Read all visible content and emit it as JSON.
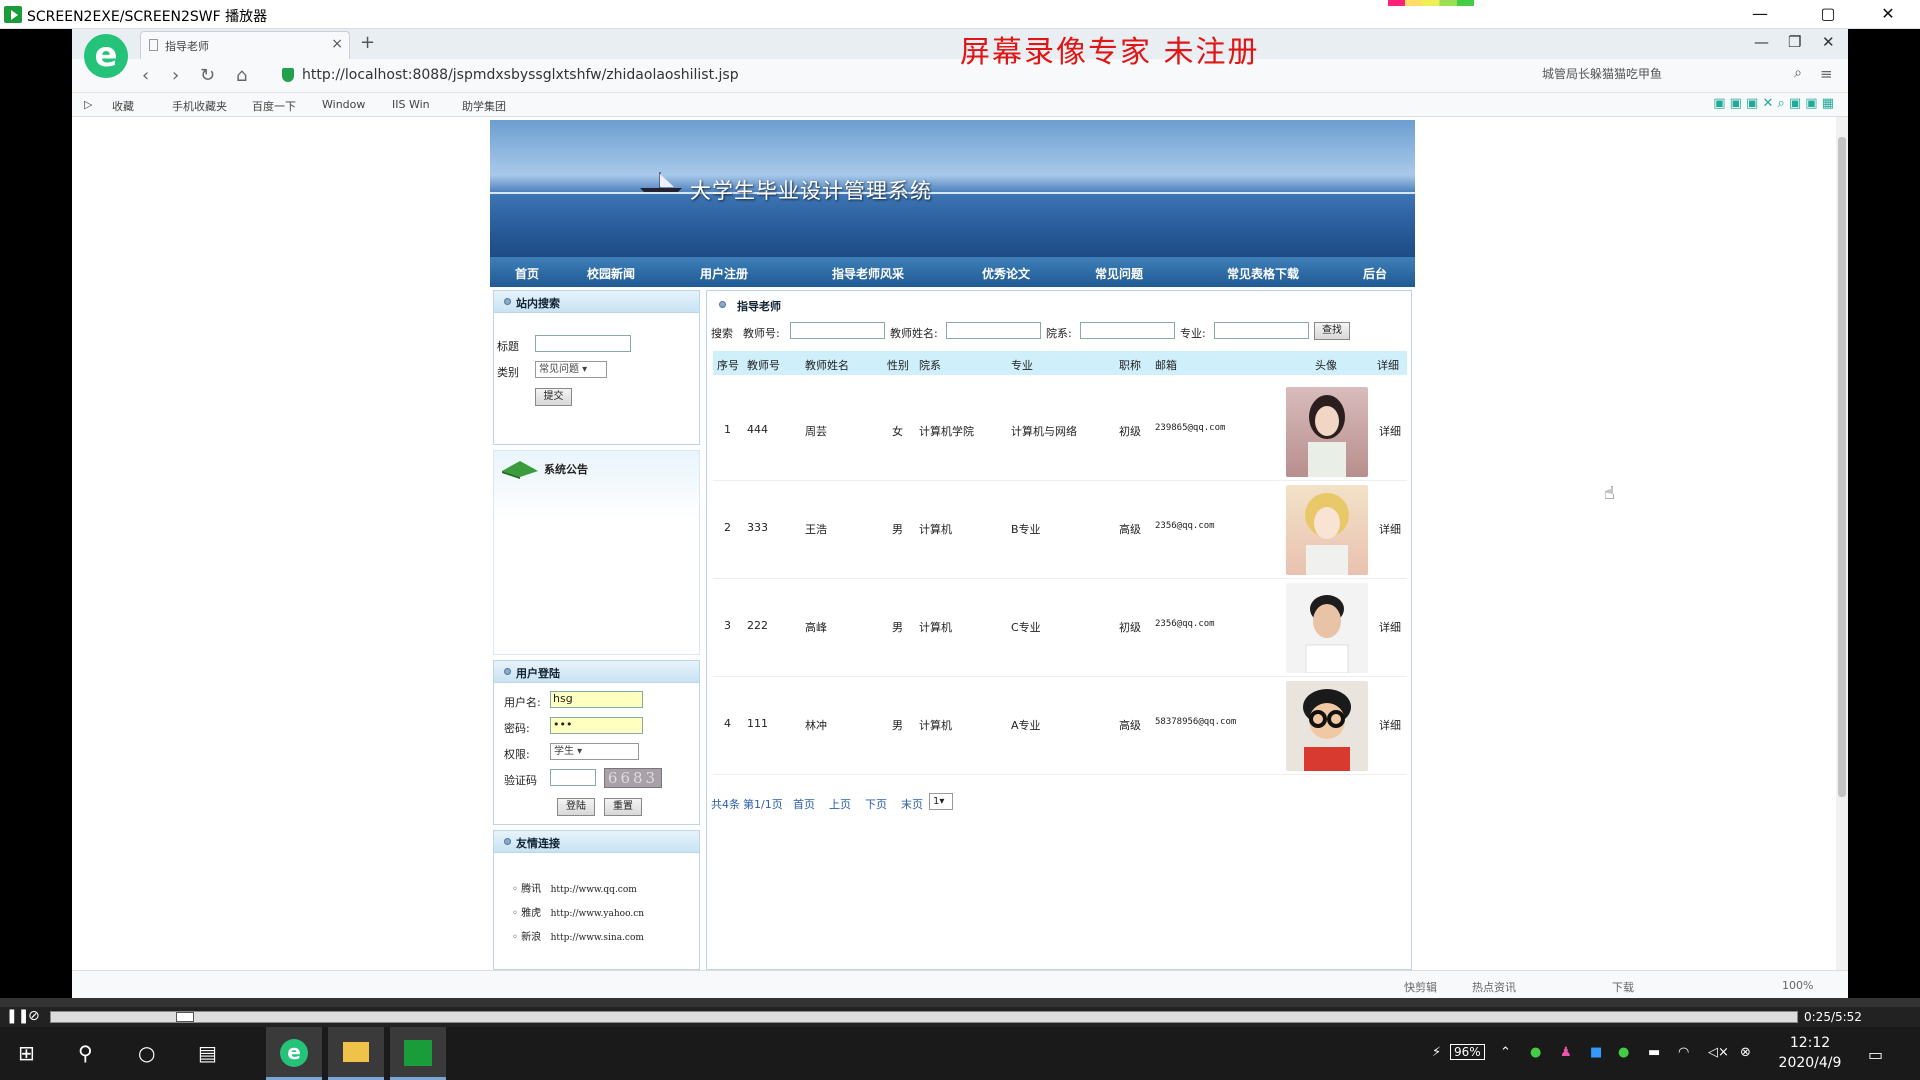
{
  "window": {
    "title": "SCREEN2EXE/SCREEN2SWF 播放器",
    "min": "—",
    "max": "▢",
    "close": "✕"
  },
  "overlay": "屏幕录像专家 未注册",
  "browser": {
    "tab_title": "指导老师",
    "url": "http://localhost:8088/jspmdxsbyssglxtshfw/zhidaolaoshilist.jsp",
    "search_text": "城管局长躲猫猫吃甲鱼",
    "bookmarks": [
      "收藏",
      "手机收藏夹",
      "百度一下",
      "Window",
      "IIS Win",
      "助学集团"
    ],
    "status": [
      "快剪辑",
      "热点资讯",
      "下载",
      "100%"
    ]
  },
  "site": {
    "banner_title": "大学生毕业设计管理系统",
    "menu": [
      "首页",
      "校园新闻",
      "用户注册",
      "指导老师风采",
      "优秀论文",
      "常见问题",
      "常见表格下载",
      "后台"
    ],
    "search_panel": {
      "title": "站内搜索",
      "label_title": "标题",
      "label_type": "类别",
      "type_value": "常见问题",
      "submit": "提交"
    },
    "notice_panel": {
      "title": "系统公告"
    },
    "login_panel": {
      "title": "用户登陆",
      "label_user": "用户名:",
      "user_value": "hsg",
      "label_pass": "密码:",
      "pass_value": "•••",
      "label_role": "权限:",
      "role_value": "学生",
      "label_code": "验证码",
      "code_value": "6683",
      "login_btn": "登陆",
      "reset_btn": "重置"
    },
    "links_panel": {
      "title": "友情连接",
      "items": [
        {
          "name": "腾讯",
          "url": "http://www.qq.com"
        },
        {
          "name": "雅虎",
          "url": "http://www.yahoo.cn"
        },
        {
          "name": "新浪",
          "url": "http://www.sina.com"
        }
      ]
    },
    "main": {
      "title": "指导老师",
      "search_label": "搜索",
      "f1": "教师号:",
      "f2": "教师姓名:",
      "f3": "院系:",
      "f4": "专业:",
      "find": "查找",
      "headers": [
        "序号",
        "教师号",
        "教师姓名",
        "性别",
        "院系",
        "专业",
        "职称",
        "邮箱",
        "头像",
        "详细"
      ],
      "rows": [
        [
          "1",
          "444",
          "周芸",
          "女",
          "计算机学院",
          "计算机与网络",
          "初级",
          "239865@qq.com",
          "详细"
        ],
        [
          "2",
          "333",
          "王浩",
          "男",
          "计算机",
          "B专业",
          "高级",
          "2356@qq.com",
          "详细"
        ],
        [
          "3",
          "222",
          "高峰",
          "男",
          "计算机",
          "C专业",
          "初级",
          "2356@qq.com",
          "详细"
        ],
        [
          "4",
          "111",
          "林冲",
          "男",
          "计算机",
          "A专业",
          "高级",
          "58378956@qq.com",
          "详细"
        ]
      ],
      "pager": {
        "total": "共4条",
        "page": "第1/1页",
        "first": "首页",
        "prev": "上页",
        "next": "下页",
        "last": "末页",
        "sel": "1"
      }
    }
  },
  "player": {
    "time": "0:25/5:52"
  },
  "taskbar": {
    "battery": "96%",
    "time": "12:12",
    "date": "2020/4/9"
  },
  "colors": {
    "accent": "#2b5f9e",
    "overlay": "#e01515"
  }
}
